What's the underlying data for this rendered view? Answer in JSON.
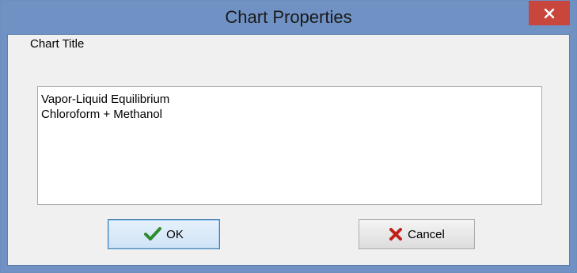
{
  "window": {
    "title": "Chart Properties",
    "close_glyph": "×"
  },
  "form": {
    "title_label": "Chart Title",
    "title_value_lines": [
      "Vapor-Liquid Equilibrium",
      "Chloroform + Methanol"
    ]
  },
  "buttons": {
    "ok": {
      "label": "OK",
      "icon": "checkmark-icon",
      "icon_color": "#2e8b2e"
    },
    "cancel": {
      "label": "Cancel",
      "icon": "x-icon",
      "icon_color": "#c0201a"
    }
  },
  "colors": {
    "titlebar": "#6f91c3",
    "close_button": "#c9463d",
    "dialog_background": "#f0f0f0"
  }
}
